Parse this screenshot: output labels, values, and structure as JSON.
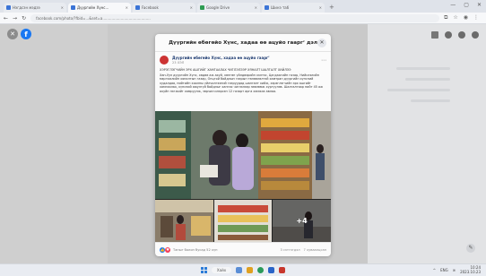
{
  "browser": {
    "tabs": [
      {
        "label": "Нэгдсэн мэдээ",
        "active": false
      },
      {
        "label": "Дүүргийн Хүнс...",
        "active": true
      },
      {
        "label": "Facebook",
        "active": false
      },
      {
        "label": "Google Drive",
        "active": false
      },
      {
        "label": "Шинэ таб",
        "active": false
      }
    ],
    "new_tab_icon": "plus-icon",
    "url": "facebook.com/photo/?fbid=...&set=a.........................................."
  },
  "modal": {
    "title": "Дүүргийн өбөгөйо Хүнс, хадаа өө ацуйо гааргʼ дэл",
    "author": "Дүүргийн өбөгөйо Хүнс, хадаа өө ацуйо гааргʼ",
    "date": "23 ХЭЛ",
    "body": [
      "ХЭРЭГЛЭГЧИЙН ЭРХ АШГИЙГ ХАМГААЛАХ ЧИГЛЭЛЭЭР ХЯНАЛТ ШАЛГАЛТ ХИЙЛЭЭ",
      "Хан-Уул дүүргийн Хүнс, хөдөө аж ахуй, хөнгөн үйлдвэрийн хэлтэс, Цагдаагийн газар, Нийслэлийн мэргэжлийн хяналтын газар, Онцгой байдлын газрын төлөөлөлтэй хамтран дүүргийн хүнсний худалдаа, нийтийн хоолны үйлчилгээний газруудад шалгалт хийж, хэрэглэгчийн эрх ашгийг хамгаалах, хүнсний аюулгүй байдлыг хангах чиглэлээр зөвлөмж хүргүүлэв. Шалгалтаар нийт 45 аж ахуйн нэгжийг хамруулж, зөрчил илэрсэн 12 газарт арга хэмжээ авлаа."
    ],
    "photo_more": "+4",
    "reactions": {
      "like_icon": "like-icon",
      "love_icon": "heart-icon",
      "text": "Таныг болон бусад 52 хүн",
      "comments": "3 сэтгэгдэл",
      "shares": "7 хуваалцсан"
    }
  },
  "taskbar": {
    "search_label": "Хайх",
    "time": "10:24",
    "date": "2023.10.23",
    "lang": "ENG"
  },
  "colors": {
    "facebook_blue": "#1877f2",
    "backdrop": "#c9c9c9"
  }
}
